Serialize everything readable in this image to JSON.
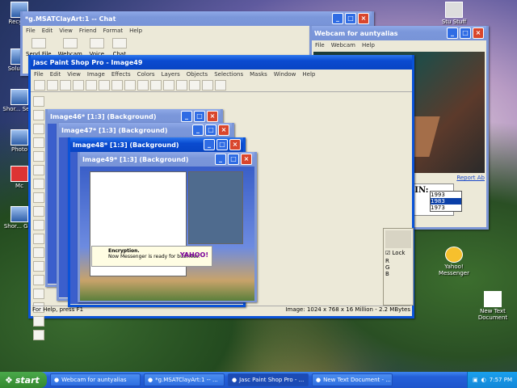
{
  "desktop": {
    "icons": [
      "Recycle",
      "Solution",
      "Shor... Seco",
      "Photo",
      "Mc",
      "Shor... Goo",
      "Stu Stuff",
      "Yahoo! Messenger",
      "New Text Document"
    ]
  },
  "chat": {
    "title": "*g.MSATClayArt:1 -- Chat",
    "menu": [
      "File",
      "Edit",
      "View",
      "Friend",
      "Format",
      "Help"
    ],
    "toolbar": [
      "Send File",
      "Webcam",
      "Voice",
      "Chat"
    ]
  },
  "webcam": {
    "title": "Webcam for auntyalias",
    "menu": [
      "File",
      "Webcam",
      "Help"
    ],
    "report": "Report Ab",
    "ad_text": "I GRADUATED IN:",
    "years": [
      "1993",
      "1983",
      "1973"
    ],
    "yahoo": "Yahoo! Messenger"
  },
  "psp": {
    "title": "Jasc Paint Shop Pro - Image49",
    "menu": [
      "File",
      "Edit",
      "View",
      "Image",
      "Effects",
      "Colors",
      "Layers",
      "Objects",
      "Selections",
      "Masks",
      "Window",
      "Help"
    ],
    "status_left": "For Help, press F1",
    "status_right": "Image: 1024 x 768 x 16 Million - 2.2 MBytes",
    "lock": "Lock",
    "rgb": [
      "R",
      "G",
      "B"
    ]
  },
  "images": [
    {
      "title": "Image46* [1:3] (Background)"
    },
    {
      "title": "Image47* [1:3] (Background)"
    },
    {
      "title": "Image48* [1:3] (Background)"
    },
    {
      "title": "Image49* [1:3] (Background)"
    }
  ],
  "inner": {
    "enc_title": "Encryption.",
    "enc_text": "Now Messenger is ready for business.",
    "yahoo": "YAHOO!"
  },
  "taskbar": {
    "start": "start",
    "tasks": [
      "Webcam for auntyalias",
      "*g.MSATClayArt:1 -- ...",
      "Jasc Paint Shop Pro - ...",
      "New Text Document - ..."
    ],
    "time": "7:57 PM"
  }
}
